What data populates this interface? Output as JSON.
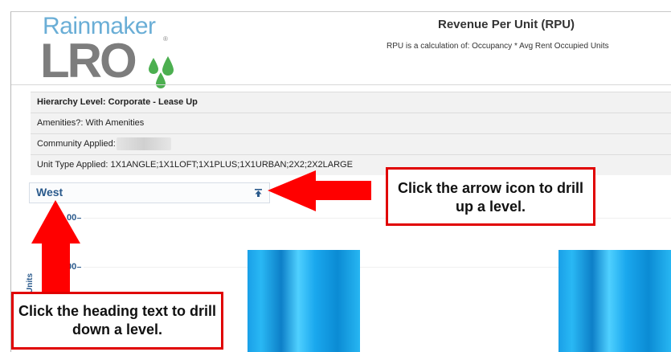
{
  "logo": {
    "top_text": "Rainmaker",
    "bottom_text": "LRO",
    "registered": "®",
    "colors": {
      "rainmaker": "#6aaed6",
      "lro": "#7d7d7d",
      "drops": "#4caf50"
    }
  },
  "report": {
    "title": "Revenue Per Unit (RPU)",
    "subtitle": "RPU is a calculation of:  Occupancy * Avg Rent Occupied Units"
  },
  "filters": {
    "hierarchy": "Hierarchy Level: Corporate - Lease Up",
    "amenities": "Amenities?:  With Amenities",
    "community_label": "Community Applied:",
    "unit_type": "Unit Type Applied: 1X1ANGLE;1X1LOFT;1X1PLUS;1X1URBAN;2X2;2X2LARGE"
  },
  "chart": {
    "heading": "West",
    "drill_up_icon": "drill-up-arrow-icon",
    "y_tick_labels": [
      "00",
      "00"
    ],
    "y_axis_title": "Units",
    "bar_color": "#1aa0e8"
  },
  "chart_data": {
    "type": "bar",
    "title": "West",
    "ylabel": "Units",
    "categories": [
      "",
      ""
    ],
    "values": [
      null,
      null
    ]
  },
  "annotations": {
    "right_callout": "Click the arrow icon to drill up a level.",
    "left_callout": "Click the heading text to drill down a level.",
    "arrow_color": "#ff0000"
  }
}
